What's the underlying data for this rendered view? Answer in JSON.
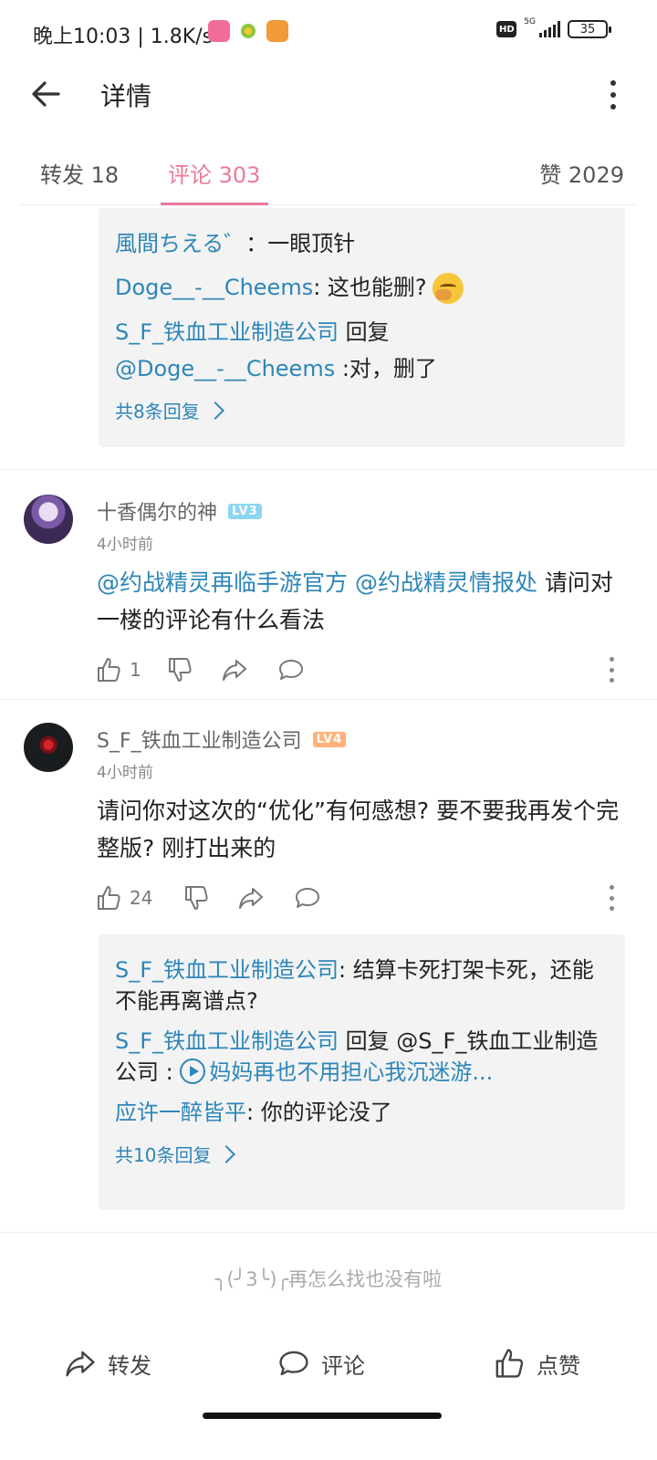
{
  "status_bar": {
    "time": "晚上10:03 | 1.8K/s",
    "hd": "HD",
    "network": "5G",
    "battery": "35"
  },
  "header": {
    "title": "详情"
  },
  "tabs": {
    "forward": "转发 18",
    "comment": "评论 303",
    "like": "赞 2029"
  },
  "reply_box_1": {
    "lines": [
      {
        "user": "風間ちえる゛",
        "text": "：一眼顶针"
      },
      {
        "user": "Doge__-__Cheems",
        "text": ": 这也能删?"
      },
      {
        "user": "S_F_铁血工业制造公司",
        "text": " 回复"
      },
      {
        "user": "@Doge__-__Cheems",
        "text": " :对，删了"
      }
    ],
    "more": "共8条回复"
  },
  "comments": [
    {
      "user": "十香偶尔的神",
      "level": "LV3",
      "time": "4小时前",
      "mention1": "@约战精灵再临手游官方",
      "mention2": "@约战精灵情报处",
      "text_tail": " 请问对一楼的评论有什么看法",
      "likes": "1"
    },
    {
      "user": "S_F_铁血工业制造公司",
      "level": "LV4",
      "time": "4小时前",
      "text": "请问你对这次的“优化”有何感想? 要不要我再发个完整版? 刚打出来的",
      "likes": "24"
    }
  ],
  "reply_box_2": {
    "line1_user": "S_F_铁血工业制造公司",
    "line1_text": ": 结算卡死打架卡死，还能不能再离谱点?",
    "line2_user": "S_F_铁血工业制造公司",
    "line2_text": " 回复 @S_F_铁血工业制造公司 : ",
    "line2_link": "妈妈再也不用担心我沉迷游...",
    "line3_user": "应许一醉皆平",
    "line3_text": ": 你的评论没了",
    "more": "共10条回复"
  },
  "end_text": "╮(╯3╰)╭再怎么找也没有啦",
  "bottom_bar": {
    "forward": "转发",
    "comment": "评论",
    "like": "点赞"
  },
  "colors": {
    "accent": "#ea7a99",
    "link": "#2d86b8",
    "reply_bg": "#f3f3f3"
  }
}
